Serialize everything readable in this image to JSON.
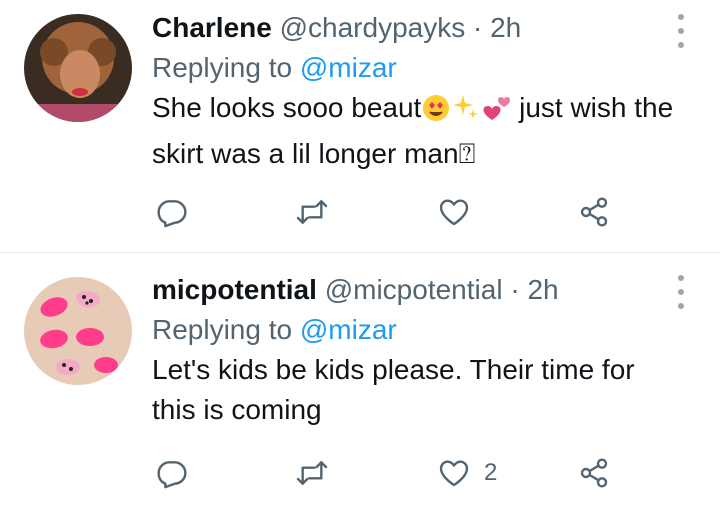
{
  "tweets": [
    {
      "name": "Charlene",
      "handle": "@chardypayks",
      "separator": "·",
      "time": "2h",
      "replying_prefix": "Replying to",
      "replying_to": "@mizar",
      "body_part1": "She looks sooo beaut",
      "body_part2": " just wish the skirt was a lil longer man",
      "body_trailing_glyph": "⍰",
      "emojis": [
        "heart-eyes-emoji",
        "sparkles-emoji",
        "two-hearts-emoji"
      ],
      "like_count": ""
    },
    {
      "name": "micpotential",
      "handle": "@micpotential",
      "separator": "·",
      "time": "2h",
      "replying_prefix": "Replying to",
      "replying_to": "@mizar",
      "body": "Let's kids be kids please. Their time for this is coming",
      "like_count": "2"
    }
  ],
  "colors": {
    "text": "#0f1419",
    "secondary": "#536471",
    "link": "#1d9bf0",
    "divider": "#e6ecf0"
  },
  "icons": [
    "reply-icon",
    "retweet-icon",
    "like-icon",
    "share-icon",
    "more-icon"
  ]
}
